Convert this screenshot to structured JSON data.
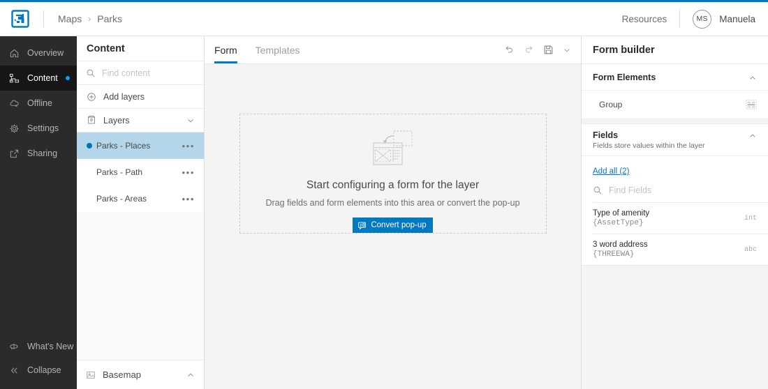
{
  "header": {
    "logo_icon": "arcgis-logo-icon",
    "breadcrumb": {
      "root": "Maps",
      "separator": "›",
      "current": "Parks"
    },
    "resources_label": "Resources",
    "user": {
      "initials": "MS",
      "name": "Manuela"
    }
  },
  "sidebar": {
    "items": [
      {
        "label": "Overview",
        "icon": "home-icon",
        "active": false,
        "dot": false
      },
      {
        "label": "Content",
        "icon": "content-tree-icon",
        "active": true,
        "dot": true
      },
      {
        "label": "Offline",
        "icon": "offline-cloud-icon",
        "active": false,
        "dot": false
      },
      {
        "label": "Settings",
        "icon": "gear-icon",
        "active": false,
        "dot": false
      },
      {
        "label": "Sharing",
        "icon": "share-export-icon",
        "active": false,
        "dot": false
      }
    ],
    "bottom_items": [
      {
        "label": "What's New",
        "icon": "megaphone-icon",
        "dot": true
      },
      {
        "label": "Collapse",
        "icon": "double-chevron-left-icon",
        "dot": false
      }
    ]
  },
  "content_panel": {
    "title": "Content",
    "search_placeholder": "Find content",
    "search_value": "",
    "add_layers_label": "Add layers",
    "layers_label": "Layers",
    "layers": [
      {
        "label": "Parks - Places",
        "selected": true
      },
      {
        "label": "Parks - Path",
        "selected": false
      },
      {
        "label": "Parks - Areas",
        "selected": false
      }
    ],
    "layer_menu_glyph": "•••",
    "basemap_label": "Basemap"
  },
  "form_area": {
    "tabs": [
      {
        "label": "Form",
        "active": true
      },
      {
        "label": "Templates",
        "active": false
      }
    ],
    "tools": [
      {
        "name": "undo-icon"
      },
      {
        "name": "redo-icon"
      },
      {
        "name": "save-icon"
      },
      {
        "name": "chevron-down-icon"
      }
    ],
    "dropzone": {
      "title": "Start configuring a form for the layer",
      "subtitle": "Drag fields and form elements into this area or convert the pop-up",
      "button_label": "Convert pop-up",
      "button_icon": "popup-icon"
    }
  },
  "form_builder": {
    "title": "Form builder",
    "form_elements": {
      "title": "Form Elements",
      "collapse_icon": "chevron-up-icon",
      "items": [
        {
          "label": "Group",
          "icon": "group-grid-icon"
        }
      ]
    },
    "fields": {
      "title": "Fields",
      "subtitle": "Fields store values within the layer",
      "collapse_icon": "chevron-up-icon",
      "add_all_label": "Add all (2)",
      "search_placeholder": "Find Fields",
      "search_value": "",
      "list": [
        {
          "alias": "Type of amenity",
          "name": "{AssetType}",
          "type": "int"
        },
        {
          "alias": "3 word address",
          "name": "{THREEWA}",
          "type": "abc"
        }
      ]
    }
  },
  "colors": {
    "accent": "#0079c1",
    "top_rule": "#0079c1",
    "sidebar_bg": "#2b2b2b",
    "sidebar_active_bg": "#161616",
    "notification_dot": "#00a0ff",
    "selected_layer_bg": "#b3d6ea",
    "layer_bullet": "#0073b5",
    "canvas_bg": "#f4f4f4"
  }
}
